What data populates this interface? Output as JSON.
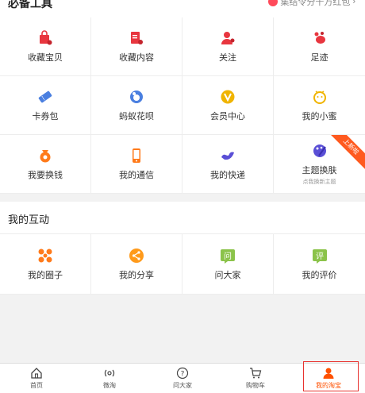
{
  "tools": {
    "title": "必备工具",
    "promo": "集结令分千万红包",
    "items": [
      {
        "label": "收藏宝贝",
        "icon": "bag-star-icon"
      },
      {
        "label": "收藏内容",
        "icon": "doc-star-icon"
      },
      {
        "label": "关注",
        "icon": "person-follow-icon"
      },
      {
        "label": "足迹",
        "icon": "footprint-icon"
      },
      {
        "label": "卡券包",
        "icon": "ticket-icon"
      },
      {
        "label": "蚂蚁花呗",
        "icon": "huabei-icon"
      },
      {
        "label": "会员中心",
        "icon": "vip-icon"
      },
      {
        "label": "我的小蜜",
        "icon": "assistant-icon"
      },
      {
        "label": "我要换钱",
        "icon": "money-bag-icon"
      },
      {
        "label": "我的通信",
        "icon": "phone-icon"
      },
      {
        "label": "我的快递",
        "icon": "bird-delivery-icon"
      },
      {
        "label": "主题换肤",
        "icon": "palette-icon",
        "sub": "点我换新主题",
        "badge": "上新啦"
      }
    ]
  },
  "interaction": {
    "title": "我的互动",
    "items": [
      {
        "label": "我的圈子",
        "icon": "circle-group-icon"
      },
      {
        "label": "我的分享",
        "icon": "share-icon"
      },
      {
        "label": "问大家",
        "icon": "ask-icon",
        "glyph": "问"
      },
      {
        "label": "我的评价",
        "icon": "review-icon",
        "glyph": "评"
      }
    ]
  },
  "tabbar": [
    {
      "label": "首页",
      "icon": "home-icon"
    },
    {
      "label": "微淘",
      "icon": "broadcast-icon"
    },
    {
      "label": "问大家",
      "icon": "question-icon"
    },
    {
      "label": "购物车",
      "icon": "cart-icon"
    },
    {
      "label": "我的淘宝",
      "icon": "user-icon",
      "active": true
    }
  ],
  "colors": {
    "red": "#e8363f",
    "orange": "#ff7a1a",
    "blue": "#4a7fe0",
    "purple": "#5a4fd6",
    "yellow": "#f0b400",
    "green": "#8bc34a",
    "active": "#ff5000"
  }
}
